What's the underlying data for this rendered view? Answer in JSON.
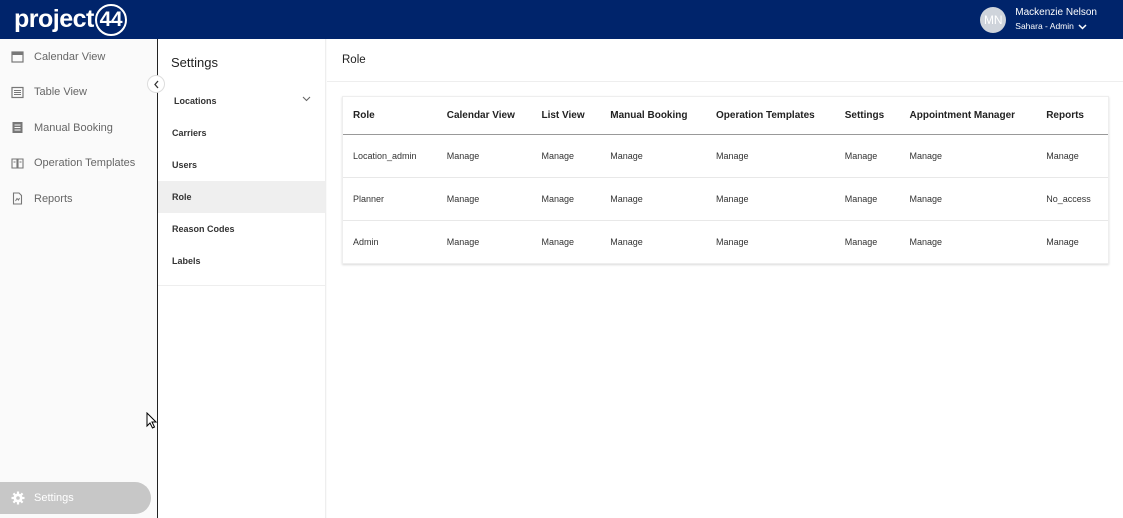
{
  "header": {
    "logo_text": "project",
    "logo_number": "44",
    "user": {
      "initials": "MN",
      "name": "Mackenzie Nelson",
      "role": "Sahara - Admin"
    }
  },
  "leftnav": {
    "items": [
      {
        "label": "Calendar View",
        "icon": "calendar-icon"
      },
      {
        "label": "Table View",
        "icon": "list-icon"
      },
      {
        "label": "Manual Booking",
        "icon": "document-icon"
      },
      {
        "label": "Operation Templates",
        "icon": "book-icon"
      },
      {
        "label": "Reports",
        "icon": "report-icon"
      }
    ],
    "settings_label": "Settings"
  },
  "settings": {
    "title": "Settings",
    "items": [
      {
        "label": "Locations"
      },
      {
        "label": "Carriers"
      },
      {
        "label": "Users"
      },
      {
        "label": "Role"
      },
      {
        "label": "Reason Codes"
      },
      {
        "label": "Labels"
      }
    ],
    "active": "Role"
  },
  "main": {
    "title": "Role",
    "table": {
      "columns": [
        "Role",
        "Calendar View",
        "List View",
        "Manual Booking",
        "Operation Templates",
        "Settings",
        "Appointment Manager",
        "Reports"
      ],
      "rows": [
        [
          "Location_admin",
          "Manage",
          "Manage",
          "Manage",
          "Manage",
          "Manage",
          "Manage",
          "Manage"
        ],
        [
          "Planner",
          "Manage",
          "Manage",
          "Manage",
          "Manage",
          "Manage",
          "Manage",
          "No_access"
        ],
        [
          "Admin",
          "Manage",
          "Manage",
          "Manage",
          "Manage",
          "Manage",
          "Manage",
          "Manage"
        ]
      ]
    }
  },
  "colors": {
    "header_bg": "#00246b",
    "active_item_bg": "#efefef",
    "settings_pill_bg": "#c7c7c7"
  }
}
